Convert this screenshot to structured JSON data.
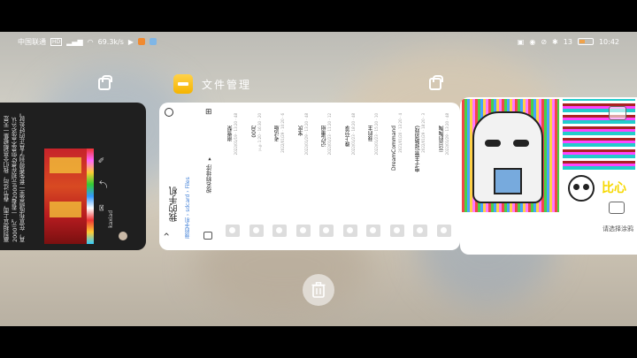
{
  "status_bar": {
    "carrier": "中国联通",
    "network": "HD",
    "speed": "69.3k/s",
    "battery_pct": "13",
    "time": "10:42"
  },
  "recents": {
    "mid_app_name": "文件管理",
    "delete_all_label": "清除全部"
  },
  "left_card": {
    "article_text": "赢到相宜上面，春节过后，我们全员都被集一天是2000元。一看看2000元现在是2你是不是这么认真，在宣布成绩是里一套免费得到了真正的好处就。",
    "avatar_label": "kaxiad"
  },
  "file_manager": {
    "page_title": "我的手机",
    "breadcrumb": [
      "我的手机",
      "sdcard",
      "Files"
    ],
    "sort_label": "按名称排序 ▾",
    "folders": [
      {
        "name": "谢雪梨",
        "meta": "2022/01/19 · 13:20 · 48"
      },
      {
        "name": "00月",
        "meta": "下午 1:20 · 16:30 · 20"
      },
      {
        "name": "考试版",
        "meta": "2022/01/29 · 10:20 · 6"
      },
      {
        "name": "宝庆",
        "meta": "2022/01/29 · 13:20 · 48"
      },
      {
        "name": "记忆重组",
        "meta": "2022/01/23 · 11:20 · 12"
      },
      {
        "name": "晚上分享",
        "meta": "2022/01/23 · 18:20 · 48"
      },
      {
        "name": "我的主",
        "meta": "2022/01/23 · 15:20 · 10"
      },
      {
        "name": "DreamCommand",
        "meta": "2021/01/20 · 13:20 · 4"
      },
      {
        "name": "电子主管(驿路游戏)",
        "meta": "2022/01/29 · 18:20 · 3"
      },
      {
        "name": "元旦的陶陶",
        "meta": "2022/01/29 · 13:20 · 48"
      }
    ]
  },
  "right_card": {
    "sticker_text": "比心",
    "bottom_label": "请选择涂鸦"
  },
  "colors": {
    "palette": [
      "#ffffff",
      "#c8c8c8",
      "#808080",
      "#000000",
      "#f5c6e6",
      "#e060c0",
      "#e01010",
      "#ffd800"
    ]
  }
}
